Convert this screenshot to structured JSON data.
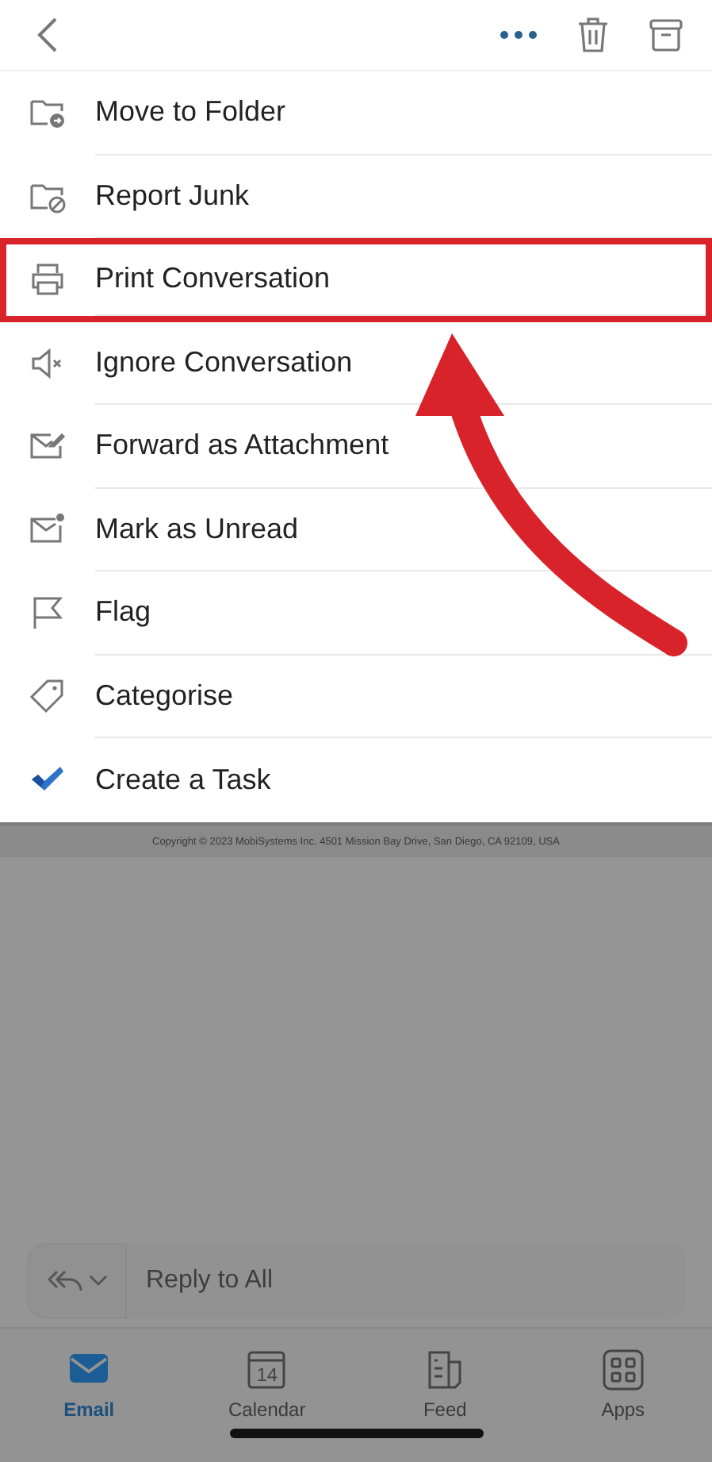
{
  "menu": [
    {
      "label": "Move to Folder",
      "highlighted": false
    },
    {
      "label": "Report Junk",
      "highlighted": false
    },
    {
      "label": "Print Conversation",
      "highlighted": true
    },
    {
      "label": "Ignore Conversation",
      "highlighted": false
    },
    {
      "label": "Forward as Attachment",
      "highlighted": false
    },
    {
      "label": "Mark as Unread",
      "highlighted": false
    },
    {
      "label": "Flag",
      "highlighted": false
    },
    {
      "label": "Categorise",
      "highlighted": false
    },
    {
      "label": "Create a Task",
      "highlighted": false
    }
  ],
  "footer": {
    "copyright": "Copyright © 2023 MobiSystems Inc. 4501 Mission Bay Drive, San Diego, CA 92109, USA"
  },
  "reply": {
    "placeholder": "Reply to All"
  },
  "tabs": [
    {
      "label": "Email",
      "selected": true
    },
    {
      "label": "Calendar",
      "selected": false,
      "day": "14"
    },
    {
      "label": "Feed",
      "selected": false
    },
    {
      "label": "Apps",
      "selected": false
    }
  ]
}
